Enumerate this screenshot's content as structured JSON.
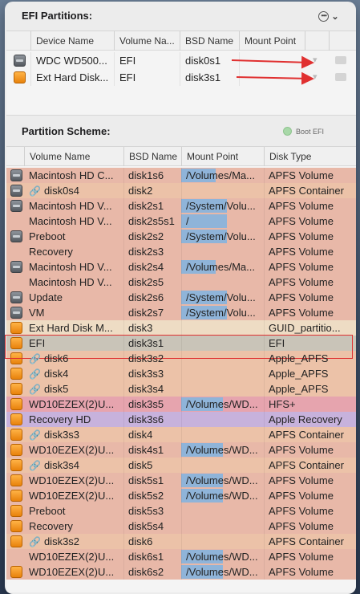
{
  "efi": {
    "title": "EFI Partitions:",
    "menu_glyph": "⌄",
    "columns": [
      "Device Name",
      "Volume Na...",
      "BSD Name",
      "Mount Point"
    ],
    "rows": [
      {
        "icon": "internal",
        "device": "WDC WD500...",
        "volume": "EFI",
        "bsd": "disk0s1",
        "mount": ""
      },
      {
        "icon": "external",
        "device": "Ext Hard Disk...",
        "volume": "EFI",
        "bsd": "disk3s1",
        "mount": ""
      }
    ]
  },
  "partitions": {
    "title": "Partition Scheme:",
    "boot_efi_label": "Boot EFI",
    "columns": [
      "Volume Name",
      "BSD Name",
      "Mount Point",
      "Disk Type"
    ],
    "rows": [
      {
        "icon": "internal",
        "link": false,
        "name": "Macintosh HD C...",
        "bsd": "disk1s6",
        "mount": "/Volumes/Ma...",
        "usage": 0.42,
        "type": "APFS Volume",
        "color": "#e8b8a8"
      },
      {
        "icon": "internal",
        "link": true,
        "name": "disk0s4",
        "bsd": "disk2",
        "mount": "",
        "usage": 0,
        "type": "APFS Container",
        "color": "#ecc2a8"
      },
      {
        "icon": "internal",
        "link": false,
        "name": "Macintosh HD V...",
        "bsd": "disk2s1",
        "mount": "/System/Volu...",
        "usage": 0.55,
        "type": "APFS Volume",
        "color": "#e8b8a8"
      },
      {
        "icon": "none",
        "link": false,
        "name": "Macintosh HD V...",
        "bsd": "disk2s5s1",
        "mount": "/",
        "usage": 0.55,
        "type": "APFS Volume",
        "color": "#e8b8a8"
      },
      {
        "icon": "internal",
        "link": false,
        "name": "Preboot",
        "bsd": "disk2s2",
        "mount": "/System/Volu...",
        "usage": 0.55,
        "type": "APFS Volume",
        "color": "#e8b8a8"
      },
      {
        "icon": "none",
        "link": false,
        "name": "Recovery",
        "bsd": "disk2s3",
        "mount": "",
        "usage": 0,
        "type": "APFS Volume",
        "color": "#e8b8a8"
      },
      {
        "icon": "internal",
        "link": false,
        "name": "Macintosh HD V...",
        "bsd": "disk2s4",
        "mount": "/Volumes/Ma...",
        "usage": 0.42,
        "type": "APFS Volume",
        "color": "#e8b8a8"
      },
      {
        "icon": "none",
        "link": false,
        "name": "Macintosh HD V...",
        "bsd": "disk2s5",
        "mount": "",
        "usage": 0,
        "type": "APFS Volume",
        "color": "#e8b8a8"
      },
      {
        "icon": "internal",
        "link": false,
        "name": "Update",
        "bsd": "disk2s6",
        "mount": "/System/Volu...",
        "usage": 0.55,
        "type": "APFS Volume",
        "color": "#e8b8a8"
      },
      {
        "icon": "internal",
        "link": false,
        "name": "VM",
        "bsd": "disk2s7",
        "mount": "/System/Volu...",
        "usage": 0.55,
        "type": "APFS Volume",
        "color": "#e8b8a8"
      },
      {
        "icon": "external",
        "link": false,
        "name": "Ext Hard Disk M...",
        "bsd": "disk3",
        "mount": "",
        "usage": 0,
        "type": "GUID_partitio...",
        "color": "#eedcc4"
      },
      {
        "icon": "external",
        "link": false,
        "name": "EFI",
        "bsd": "disk3s1",
        "mount": "",
        "usage": 0,
        "type": "EFI",
        "color": "#c9c4b8"
      },
      {
        "icon": "external",
        "link": true,
        "name": "disk6",
        "bsd": "disk3s2",
        "mount": "",
        "usage": 0,
        "type": "Apple_APFS",
        "color": "#ecc2a8"
      },
      {
        "icon": "external",
        "link": true,
        "name": "disk4",
        "bsd": "disk3s3",
        "mount": "",
        "usage": 0,
        "type": "Apple_APFS",
        "color": "#ecc2a8"
      },
      {
        "icon": "external",
        "link": true,
        "name": "disk5",
        "bsd": "disk3s4",
        "mount": "",
        "usage": 0,
        "type": "Apple_APFS",
        "color": "#ecc2a8"
      },
      {
        "icon": "external",
        "link": false,
        "name": "WD10EZEX(2)U...",
        "bsd": "disk3s5",
        "mount": "/Volumes/WD...",
        "usage": 0.5,
        "type": "HFS+",
        "color": "#e6a4ae"
      },
      {
        "icon": "external",
        "link": false,
        "name": "Recovery HD",
        "bsd": "disk3s6",
        "mount": "",
        "usage": 0,
        "type": "Apple Recovery",
        "color": "#c7b2dc"
      },
      {
        "icon": "external",
        "link": true,
        "name": "disk3s3",
        "bsd": "disk4",
        "mount": "",
        "usage": 0,
        "type": "APFS Container",
        "color": "#ecc2a8"
      },
      {
        "icon": "external",
        "link": false,
        "name": "WD10EZEX(2)U...",
        "bsd": "disk4s1",
        "mount": "/Volumes/WD...",
        "usage": 0.5,
        "type": "APFS Volume",
        "color": "#e8b8a8"
      },
      {
        "icon": "external",
        "link": true,
        "name": "disk3s4",
        "bsd": "disk5",
        "mount": "",
        "usage": 0,
        "type": "APFS Container",
        "color": "#ecc2a8"
      },
      {
        "icon": "external",
        "link": false,
        "name": "WD10EZEX(2)U...",
        "bsd": "disk5s1",
        "mount": "/Volumes/WD...",
        "usage": 0.5,
        "type": "APFS Volume",
        "color": "#e8b8a8"
      },
      {
        "icon": "external",
        "link": false,
        "name": "WD10EZEX(2)U...",
        "bsd": "disk5s2",
        "mount": "/Volumes/WD...",
        "usage": 0.5,
        "type": "APFS Volume",
        "color": "#e8b8a8"
      },
      {
        "icon": "external",
        "link": false,
        "name": "Preboot",
        "bsd": "disk5s3",
        "mount": "",
        "usage": 0,
        "type": "APFS Volume",
        "color": "#e8b8a8"
      },
      {
        "icon": "external",
        "link": false,
        "name": "Recovery",
        "bsd": "disk5s4",
        "mount": "",
        "usage": 0,
        "type": "APFS Volume",
        "color": "#e8b8a8"
      },
      {
        "icon": "external",
        "link": true,
        "name": "disk3s2",
        "bsd": "disk6",
        "mount": "",
        "usage": 0,
        "type": "APFS Container",
        "color": "#ecc2a8"
      },
      {
        "icon": "none",
        "link": false,
        "name": "WD10EZEX(2)U...",
        "bsd": "disk6s1",
        "mount": "/Volumes/WD...",
        "usage": 0.5,
        "type": "APFS Volume",
        "color": "#e8b8a8"
      },
      {
        "icon": "external",
        "link": false,
        "name": "WD10EZEX(2)U...",
        "bsd": "disk6s2",
        "mount": "/Volumes/WD...",
        "usage": 0.5,
        "type": "APFS Volume",
        "color": "#e8b8a8"
      }
    ]
  },
  "annotation_color": "#e03030"
}
